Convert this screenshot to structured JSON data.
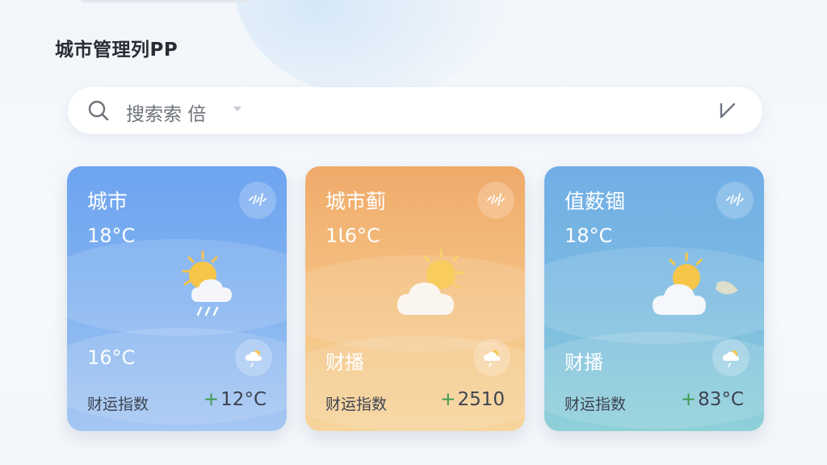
{
  "header": {
    "title": "城市管理列PP"
  },
  "search": {
    "placeholder": "搜索索 倍"
  },
  "cards": [
    {
      "city": "城市",
      "temp": "18°C",
      "sub": "16°C",
      "index_label": "财运指数",
      "index_value": "12°C",
      "plus": "+",
      "weather": "sun-cloud-rain"
    },
    {
      "city": "城市蓟",
      "temp": "1Ɩ6°C",
      "sub": "财播",
      "index_label": "财运指数",
      "index_value": "2510",
      "plus": "+",
      "weather": "sun-cloud"
    },
    {
      "city": "值薮锢",
      "temp": "18°C",
      "sub": "财播",
      "index_label": "财运指数",
      "index_value": "83°C",
      "plus": "+",
      "weather": "sun-cloud-moon"
    }
  ],
  "colors": {
    "accent_plus": "#3c9a4d",
    "card1": "#6ea4f0",
    "card2": "#f0aa6a",
    "card3": "#71aee6"
  }
}
